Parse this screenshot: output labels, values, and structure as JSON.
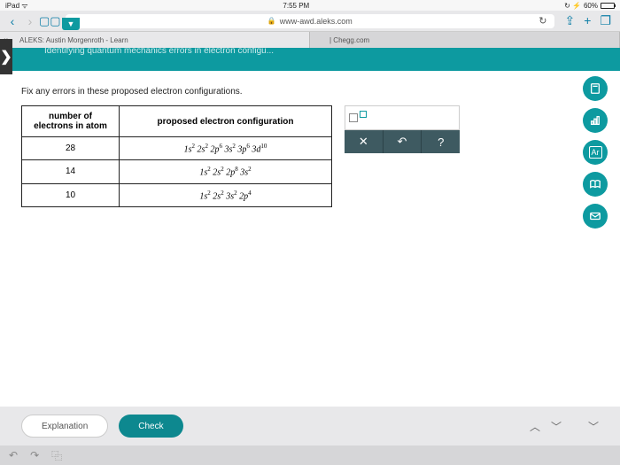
{
  "status": {
    "device": "iPad",
    "wifi": "ᯤ",
    "time": "7:55 PM",
    "batt_pct": "60%"
  },
  "browser": {
    "url": "www-awd.aleks.com",
    "lock": "🔒"
  },
  "tabs": [
    {
      "label": "ALEKS: Austin Morgenroth - Learn",
      "active": true
    },
    {
      "label": "| Chegg.com",
      "active": false
    }
  ],
  "header": {
    "title": "Identifying quantum mechanics errors in electron configu..."
  },
  "instruction": "Fix any errors in these proposed electron configurations.",
  "table": {
    "headers": {
      "num": "number of electrons in atom",
      "conf": "proposed electron configuration"
    },
    "rows": [
      {
        "n": "28",
        "conf_html": "1<i>s</i><sup>2</sup> 2<i>s</i><sup>2</sup> 2<i>p</i><sup>6</sup> 3<i>s</i><sup>2</sup> 3<i>p</i><sup>6</sup> 3<i>d</i><sup>10</sup>"
      },
      {
        "n": "14",
        "conf_html": "1<i>s</i><sup>2</sup> 2<i>s</i><sup>2</sup> 2<i>p</i><sup>8</sup> 3<i>s</i><sup>2</sup>"
      },
      {
        "n": "10",
        "conf_html": "1<i>s</i><sup>2</sup> 2<i>s</i><sup>2</sup> 3<i>s</i><sup>2</sup> 2<i>p</i><sup>4</sup>"
      }
    ]
  },
  "tools": {
    "clear": "✕",
    "undo": "↶",
    "help": "?"
  },
  "circle_tools": {
    "calc": "calculator",
    "stats": "bar-chart",
    "periodic": "Ar",
    "book": "open-book",
    "mail": "envelope"
  },
  "buttons": {
    "explanation": "Explanation",
    "check": "Check"
  },
  "nav": {
    "up": "︿",
    "down": "﹀",
    "down2": "﹀"
  },
  "footer": {
    "undo": "↶",
    "redo": "↷",
    "copy": "⿻"
  }
}
